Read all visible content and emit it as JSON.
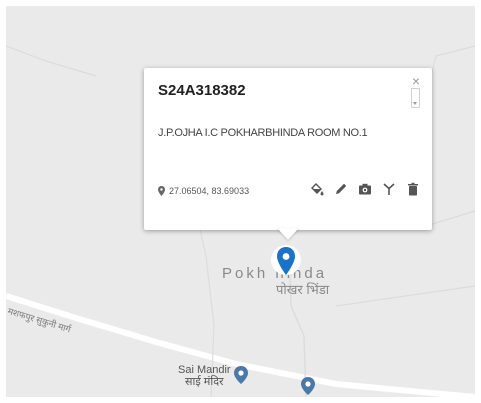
{
  "popup": {
    "title": "S24A318382",
    "close_label": "×",
    "address": "J.P.OJHA I.C POKHARBHINDA ROOM NO.1",
    "coordinates": "27.06504, 83.69033",
    "toolbar": [
      {
        "name": "fill-bucket-icon"
      },
      {
        "name": "pencil-icon"
      },
      {
        "name": "camera-icon"
      },
      {
        "name": "antenna-icon"
      },
      {
        "name": "trash-icon"
      }
    ]
  },
  "map": {
    "place_label_en": "Pokh   hinda",
    "place_label_hi": "पोखर भिंडा",
    "road_label": "मशफपुर सुकुनी मार्ग",
    "poi": {
      "name_en": "Sai Mandir",
      "name_hi": "साई मंदिर"
    },
    "colors": {
      "background": "#eaeaea",
      "road": "#ffffff",
      "minor_road": "#dcdcdc",
      "selected_marker": "#1a73c8",
      "poi_marker": "#4a78a8"
    }
  }
}
